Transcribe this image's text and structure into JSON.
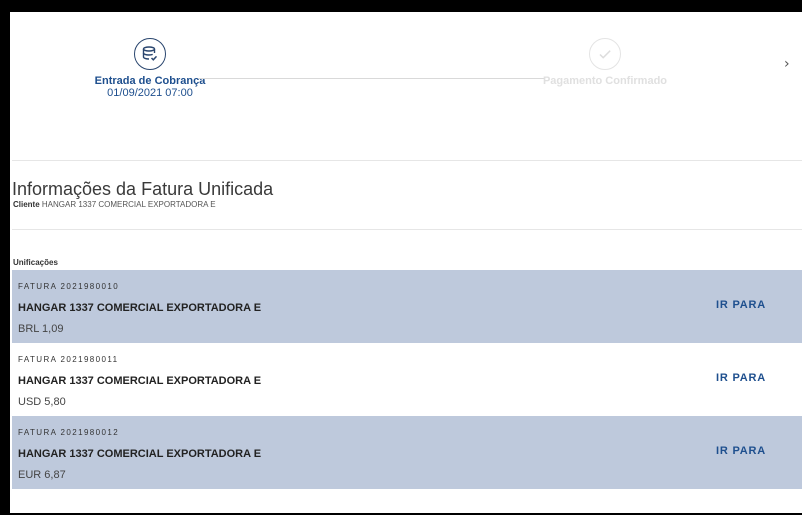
{
  "stepper": {
    "steps": [
      {
        "title": "Entrada de Cobrança",
        "date": "01/09/2021 07:00",
        "state": "active"
      },
      {
        "title": "Pagamento Confirmado",
        "date": "",
        "state": "inactive"
      }
    ],
    "next_icon": "chevron-right-icon"
  },
  "invoice": {
    "title": "Informações da Fatura Unificada",
    "client_label": "Cliente",
    "client_name": "HANGAR 1337 COMERCIAL EXPORTADORA E"
  },
  "unifications": {
    "label": "Unificações",
    "items": [
      {
        "number": "FATURA 2021980010",
        "name": "HANGAR 1337 COMERCIAL EXPORTADORA E",
        "amount": "BRL  1,09",
        "link": "IR PARA",
        "shaded": true
      },
      {
        "number": "FATURA 2021980011",
        "name": "HANGAR 1337 COMERCIAL EXPORTADORA E",
        "amount": "USD  5,80",
        "link": "IR PARA",
        "shaded": false
      },
      {
        "number": "FATURA 2021980012",
        "name": "HANGAR 1337 COMERCIAL EXPORTADORA E",
        "amount": "EUR  6,87",
        "link": "IR PARA",
        "shaded": true
      }
    ]
  },
  "colors": {
    "accent": "#1e4f8e",
    "row_shade": "#bec9dc",
    "inactive": "#e0e0e0"
  }
}
